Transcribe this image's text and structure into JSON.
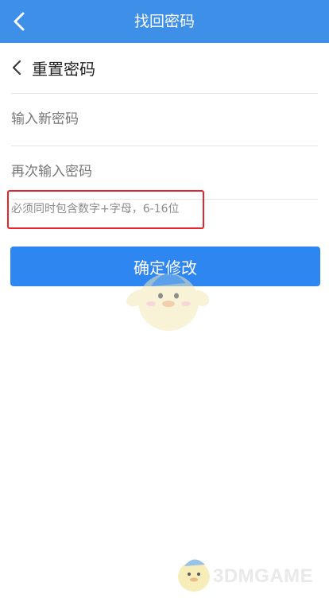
{
  "header": {
    "title": "找回密码",
    "back_icon": "chevron-left-icon"
  },
  "section": {
    "title": "重置密码",
    "back_icon": "chevron-left-icon"
  },
  "form": {
    "new_password_placeholder": "输入新密码",
    "new_password_value": "",
    "confirm_password_placeholder": "再次输入密码",
    "confirm_password_value": "",
    "hint": "必须同时包含数字+字母，6-16位",
    "submit_label": "确定修改"
  },
  "watermark": {
    "text": "3DMGAME"
  },
  "colors": {
    "header_bg": "#3d8fe8",
    "button_bg": "#2e86f0",
    "highlight_border": "#e8232a"
  }
}
